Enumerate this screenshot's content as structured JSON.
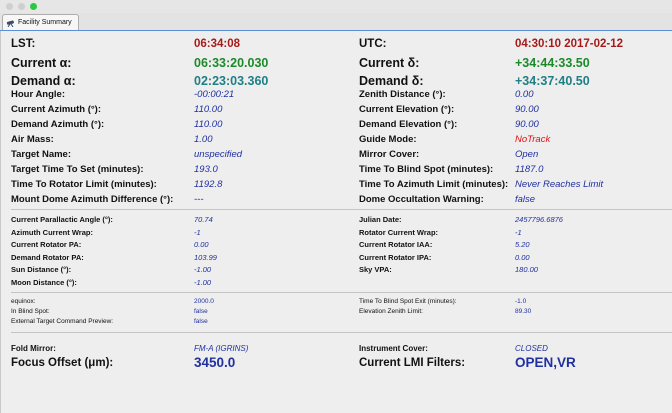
{
  "window": {
    "tab_title": "Facility Summary"
  },
  "colors": {
    "red": "#a61a1a",
    "green": "#1d8a2a",
    "teal": "#1f7f84",
    "blue": "#2030a0",
    "alert": "#e01010"
  },
  "rows1": [
    {
      "ll": "LST:",
      "lv": "06:34:08",
      "lc": "red",
      "rl": "UTC:",
      "rv": "04:30:10 2017-02-12",
      "rc": "red",
      "size": "l",
      "bold": true
    },
    {
      "ll": "Current α:",
      "lv": "06:33:20.030",
      "lc": "green",
      "rl": "Current δ:",
      "rv": "+34:44:33.50",
      "rc": "green",
      "size": "xl",
      "bold": true
    },
    {
      "ll": "Demand α:",
      "lv": "02:23:03.360",
      "lc": "teal",
      "rl": "Demand δ:",
      "rv": "+34:37:40.50",
      "rc": "teal",
      "size": "xl",
      "bold": true
    },
    {
      "ll": "Hour Angle:",
      "lv": "-00:00:21",
      "lc": "blue",
      "rl": "Zenith Distance (°):",
      "rv": "0.00",
      "rc": "blue",
      "size": "m"
    },
    {
      "ll": "Current Azimuth (°):",
      "lv": "110.00",
      "lc": "blue",
      "rl": "Current Elevation (°):",
      "rv": "90.00",
      "rc": "blue",
      "size": "m"
    },
    {
      "ll": "Demand Azimuth (°):",
      "lv": "110.00",
      "lc": "blue",
      "rl": "Demand Elevation (°):",
      "rv": "90.00",
      "rc": "blue",
      "size": "m"
    },
    {
      "ll": "Air Mass:",
      "lv": "1.00",
      "lc": "blue",
      "rl": "Guide Mode:",
      "rv": "NoTrack",
      "rc": "alert",
      "size": "m"
    },
    {
      "ll": "Target Name:",
      "lv": "unspecified",
      "lc": "blue",
      "rl": "Mirror Cover:",
      "rv": "Open",
      "rc": "blue",
      "size": "m"
    },
    {
      "ll": "Target Time To Set (minutes):",
      "lv": "193.0",
      "lc": "blue",
      "rl": "Time To Blind Spot (minutes):",
      "rv": "1187.0",
      "rc": "blue",
      "size": "m"
    },
    {
      "ll": "Time To Rotator Limit (minutes):",
      "lv": "1192.8",
      "lc": "blue",
      "rl": "Time To Azimuth Limit (minutes):",
      "rv": "Never Reaches Limit",
      "rc": "blue",
      "size": "m"
    },
    {
      "ll": "Mount Dome Azimuth Difference (°):",
      "lv": "---",
      "lc": "blue",
      "rl": "Dome Occultation Warning:",
      "rv": "false",
      "rc": "blue",
      "size": "m"
    }
  ],
  "rows2": [
    {
      "ll": "Current Parallactic Angle (°):",
      "lv": "70.74",
      "rl": "Julian Date:",
      "rv": "2457796.6876"
    },
    {
      "ll": "Azimuth Current Wrap:",
      "lv": "-1",
      "rl": "Rotator Current Wrap:",
      "rv": "-1"
    },
    {
      "ll": "Current Rotator PA:",
      "lv": "0.00",
      "rl": "Current Rotator IAA:",
      "rv": "5.20"
    },
    {
      "ll": "Demand Rotator PA:",
      "lv": "103.99",
      "rl": "Current Rotator IPA:",
      "rv": "0.00"
    },
    {
      "ll": "Sun Distance (°):",
      "lv": "-1.00",
      "rl": "Sky VPA:",
      "rv": "180.00"
    },
    {
      "ll": "Moon Distance (°):",
      "lv": "-1.00",
      "rl": "",
      "rv": ""
    }
  ],
  "rows3": [
    {
      "ll": "equinox:",
      "lv": "2000.0",
      "rl": "Time To Blind Spot Exit (minutes):",
      "rv": "-1.0"
    },
    {
      "ll": "In Blind Spot:",
      "lv": "false",
      "rl": "Elevation Zenith Limit:",
      "rv": "89.30"
    },
    {
      "ll": "External Target Command Preview:",
      "lv": "false",
      "rl": "",
      "rv": ""
    }
  ],
  "rows4": [
    {
      "ll": "Fold Mirror:",
      "lv": "FM-A (IGRINS)",
      "rl": "Instrument Cover:",
      "rv": "CLOSED",
      "size": "s4"
    },
    {
      "ll": "Focus Offset (μm):",
      "lv": "3450.0",
      "rl": "Current LMI Filters:",
      "rv": "OPEN,VR",
      "size": "l4"
    }
  ]
}
